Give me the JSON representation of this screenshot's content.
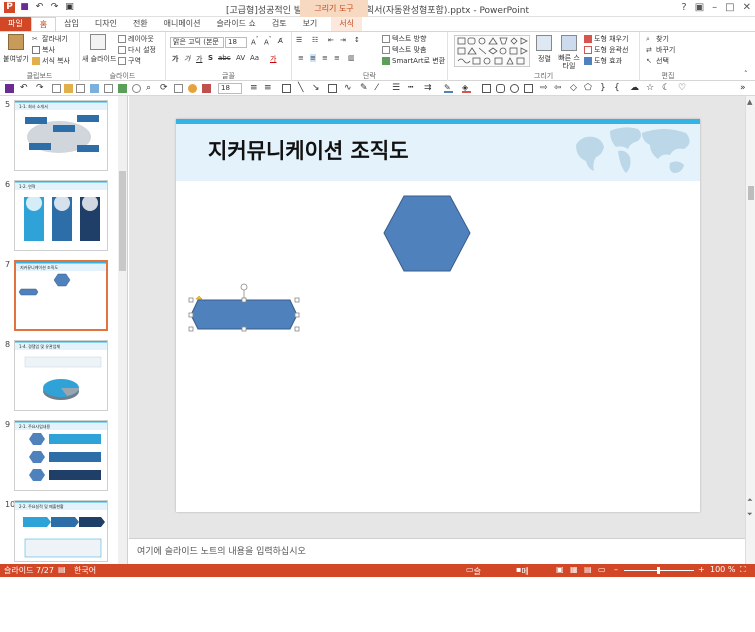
{
  "titlebar": {
    "title": "[고급형]성공적인 발표를 위한 사업계획서(자동완성형포함).pptx - PowerPoint",
    "context_tool": "그리기 도구"
  },
  "tabs": [
    "파일",
    "홈",
    "삽입",
    "디자인",
    "전환",
    "애니메이션",
    "슬라이드 쇼",
    "검토",
    "보기",
    "서식"
  ],
  "ribbon": {
    "clipboard": {
      "paste": "붙여넣기",
      "cut": "잘라내기",
      "copy": "복사",
      "format_painter": "서식 복사",
      "label": "클립보드"
    },
    "slides": {
      "new_slide": "새 슬라이드",
      "layout": "레이아웃",
      "reset": "다시 설정",
      "section": "구역",
      "label": "슬라이드"
    },
    "font": {
      "font_name": "맑은 고딕 (본문",
      "font_size": "18",
      "label": "글꼴"
    },
    "paragraph": {
      "text_direction": "텍스트 방향",
      "align_text": "텍스트 맞춤",
      "smartart": "SmartArt로 변환",
      "label": "단락"
    },
    "drawing": {
      "arrange": "정렬",
      "quick_styles": "빠른 스타일",
      "shape_fill": "도형 채우기",
      "shape_outline": "도형 윤곽선",
      "shape_effects": "도형 효과",
      "label": "그리기"
    },
    "editing": {
      "find": "찾기",
      "replace": "바꾸기",
      "select": "선택",
      "label": "편집"
    }
  },
  "toolbar2": {
    "font_size": "18"
  },
  "thumbnails": [
    {
      "num": "5",
      "title": "1-1. 회사 소개서"
    },
    {
      "num": "6",
      "title": "1-2. 연혁"
    },
    {
      "num": "7",
      "title": "지커뮤니케이션 조직도"
    },
    {
      "num": "8",
      "title": "1-4. 경쟁업 및 유관업체"
    },
    {
      "num": "9",
      "title": "2-1. 주요사업내용"
    },
    {
      "num": "10",
      "title": "2-2. 주요실적 및 매출현황"
    }
  ],
  "slide": {
    "title": "지커뮤니케이션 조직도"
  },
  "notes": {
    "placeholder": "여기에 슬라이드 노트의 내용을 입력하십시오"
  },
  "status": {
    "slide_info": "슬라이드 7/27",
    "language": "한국어",
    "notes_btn": "슬라이드 노트",
    "comments_btn": "메모",
    "zoom": "100 %"
  },
  "colors": {
    "accent": "#d24726",
    "shape_fill": "#4f81bd",
    "shape_stroke": "#385d8a",
    "header_band": "#e4f3fb"
  }
}
